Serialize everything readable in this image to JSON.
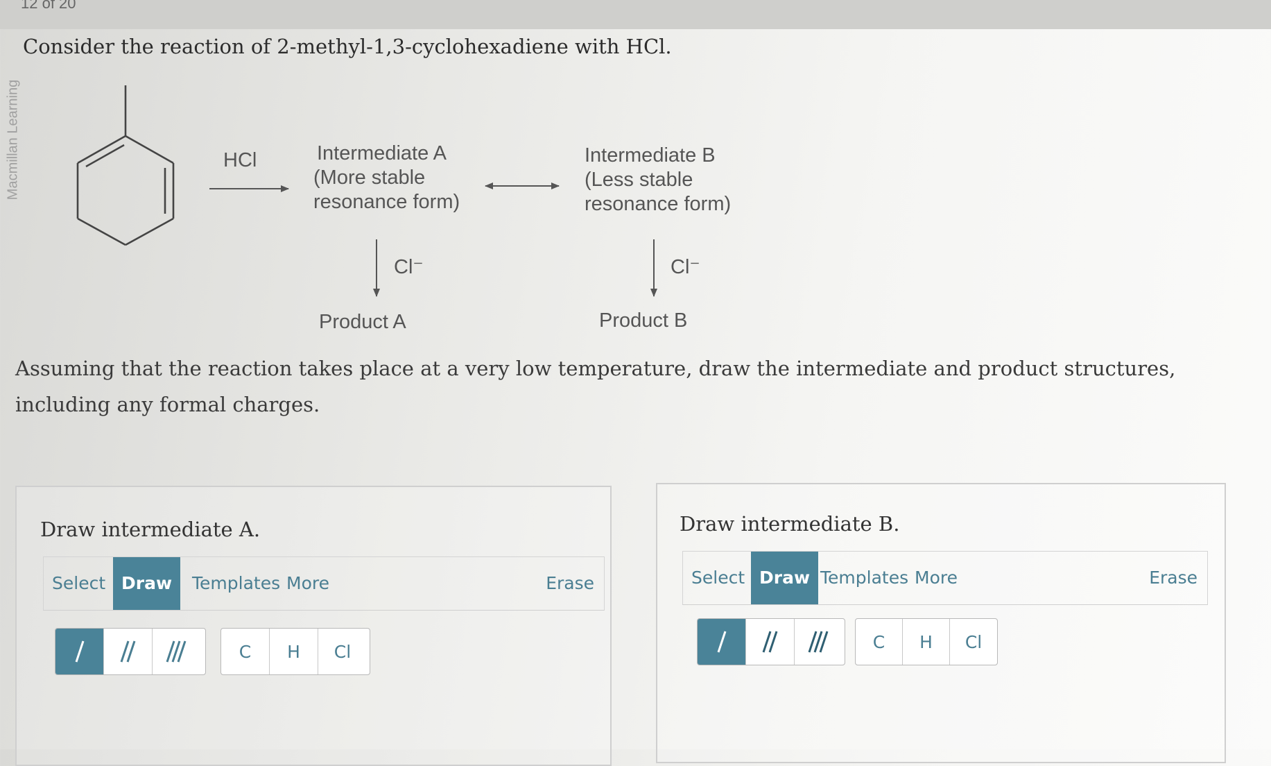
{
  "header": {
    "fragment": "12 of 20"
  },
  "side_brand": "Macmillan Learning",
  "question": "Consider the reaction of 2-methyl-1,3-cyclohexadiene with HCl.",
  "scheme": {
    "reagent": "HCl",
    "intermediate_a": [
      "Intermediate A",
      "(More stable",
      "resonance form)"
    ],
    "intermediate_b": [
      "Intermediate B",
      "(Less stable",
      "resonance form)"
    ],
    "nucleophile_a": "Cl⁻",
    "nucleophile_b": "Cl⁻",
    "product_a": "Product A",
    "product_b": "Product B"
  },
  "instruction": "Assuming that the reaction takes place at a very low temperature, draw the intermediate and product structures, including any formal charges.",
  "panels": [
    {
      "title": "Draw intermediate A.",
      "tabs": [
        "Select",
        "Draw",
        "Templates",
        "More"
      ],
      "active_tab": "Draw",
      "erase_label": "Erase",
      "bond_tools": [
        "/",
        "//",
        "///"
      ],
      "atom_tools": [
        "C",
        "H",
        "Cl"
      ]
    },
    {
      "title": "Draw intermediate B.",
      "tabs": [
        "Select",
        "Draw",
        "Templates",
        "More"
      ],
      "active_tab": "Draw",
      "erase_label": "Erase",
      "bond_tools": [
        "/",
        "//",
        "///"
      ],
      "atom_tools": [
        "C",
        "H",
        "Cl"
      ]
    }
  ],
  "colors": {
    "accent": "#4a8398",
    "link": "#4a7e92"
  }
}
